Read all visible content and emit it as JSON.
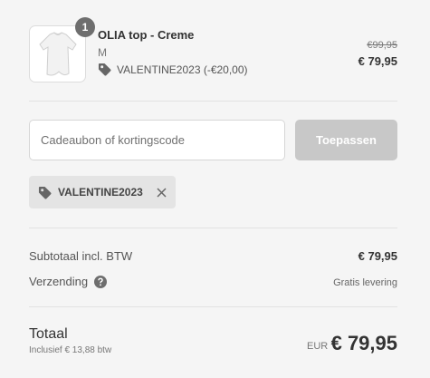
{
  "product": {
    "quantity": "1",
    "name": "OLIA top - Creme",
    "variant": "M",
    "discount_line": "VALENTINE2023 (-€20,00)",
    "original_price": "€99,95",
    "price": "€ 79,95",
    "image_icon": "shirt-icon"
  },
  "discount_form": {
    "placeholder": "Cadeaubon of kortingscode",
    "apply_label": "Toepassen",
    "button_color": "#c8c8c8"
  },
  "applied_code": {
    "code": "VALENTINE2023",
    "icon": "tag-icon",
    "remove_icon": "close-icon"
  },
  "summary": {
    "subtotal_label": "Subtotaal incl. BTW",
    "subtotal_value": "€ 79,95",
    "shipping_label": "Verzending",
    "shipping_value": "Gratis levering",
    "help_icon": "question-icon"
  },
  "total": {
    "label": "Totaal",
    "tax_note": "Inclusief € 13,88 btw",
    "currency": "EUR",
    "amount": "€ 79,95"
  }
}
